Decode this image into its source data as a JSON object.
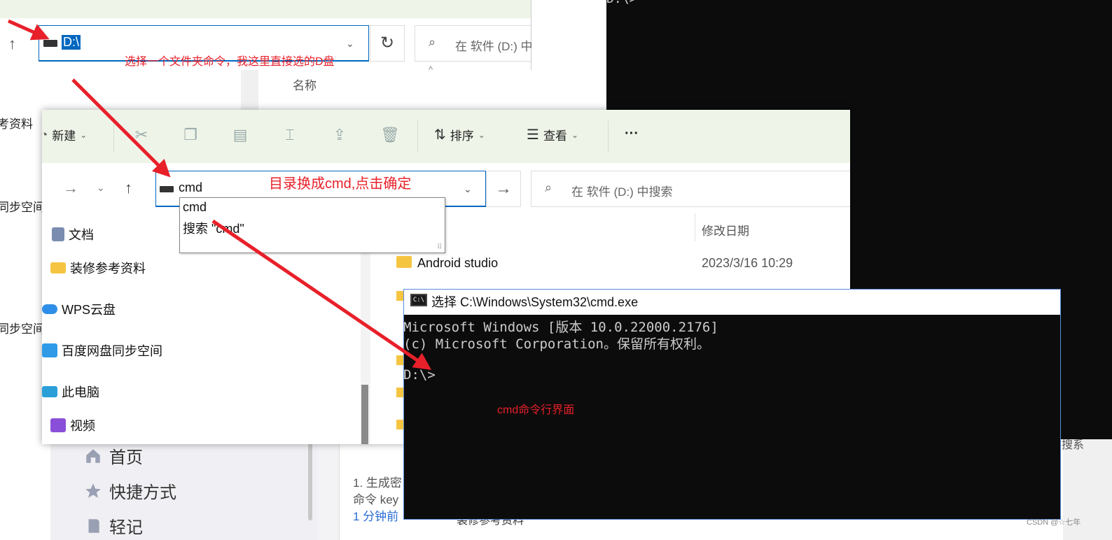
{
  "background_console": {
    "prompt": "D:\\>"
  },
  "note_app": {
    "nav": [
      {
        "label": "首页",
        "icon": "home-icon"
      },
      {
        "label": "快捷方式",
        "icon": "star-icon"
      },
      {
        "label": "轻记",
        "icon": "note-icon"
      }
    ],
    "content_lines": [
      "1. 生成密",
      "命令 key"
    ],
    "date": "1 分钟前",
    "folder_item": "装修参考资料",
    "right_text": "搜系"
  },
  "back_explorer": {
    "address_value": "D:\\",
    "search_placeholder": "在 软件 (D:) 中",
    "column_name": "名称",
    "side_items": [
      "考资料",
      "同步空间",
      "同步空间"
    ]
  },
  "front_explorer": {
    "ribbon": {
      "new_label": "新建",
      "sort_label": "排序",
      "view_label": "查看",
      "more_label": "···"
    },
    "address_value": "cmd",
    "search_placeholder": "在 软件 (D:) 中搜索",
    "column_date": "修改日期",
    "sidebar": [
      {
        "label": "文档",
        "icon": "documents-icon"
      },
      {
        "label": "装修参考资料",
        "icon": "folder-icon"
      },
      {
        "label": "WPS云盘",
        "icon": "cloud-icon"
      },
      {
        "label": "百度网盘同步空间",
        "icon": "baidu-netdisk-icon"
      },
      {
        "label": "此电脑",
        "icon": "computer-icon"
      },
      {
        "label": "视频",
        "icon": "video-icon"
      }
    ],
    "rows": [
      {
        "name": "Android studio",
        "date": "2023/3/16 10:29"
      }
    ],
    "autocomplete": [
      "cmd",
      "搜索 \"cmd\""
    ]
  },
  "cmd_window": {
    "title": "选择 C:\\Windows\\System32\\cmd.exe",
    "lines": [
      "Microsoft Windows [版本 10.0.22000.2176]",
      "(c) Microsoft Corporation。保留所有权利。",
      "",
      "D:\\>"
    ]
  },
  "annotations": {
    "select_folder": "选择一个文件夹命令，我这里直接选的D盘",
    "replace_dir": "目录换成cmd,点击确定",
    "cmd_interface": "cmd命令行界面"
  },
  "watermark": "CSDN @☆七年",
  "colors": {
    "annotation_red": "#e8202a",
    "accent_blue": "#0067c0",
    "console_bg": "#0c0c0c"
  }
}
